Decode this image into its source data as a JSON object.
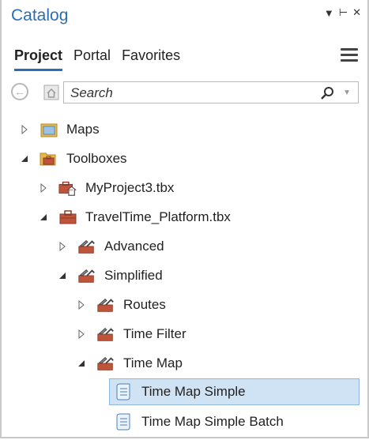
{
  "panel": {
    "title": "Catalog"
  },
  "tabs": [
    {
      "label": "Project",
      "active": true
    },
    {
      "label": "Portal",
      "active": false
    },
    {
      "label": "Favorites",
      "active": false
    }
  ],
  "search": {
    "placeholder": "Search"
  },
  "tree": [
    {
      "label": "Maps",
      "icon": "maps-folder-icon",
      "expanded": false
    },
    {
      "label": "Toolboxes",
      "icon": "folder-open-icon",
      "expanded": true
    },
    {
      "label": "MyProject3.tbx",
      "icon": "toolbox-home-icon",
      "expanded": false
    },
    {
      "label": "TravelTime_Platform.tbx",
      "icon": "toolbox-icon",
      "expanded": true
    },
    {
      "label": "Advanced",
      "icon": "toolset-icon",
      "expanded": false
    },
    {
      "label": "Simplified",
      "icon": "toolset-icon",
      "expanded": true
    },
    {
      "label": "Routes",
      "icon": "toolset-icon",
      "expanded": false
    },
    {
      "label": "Time Filter",
      "icon": "toolset-icon",
      "expanded": false
    },
    {
      "label": "Time Map",
      "icon": "toolset-icon",
      "expanded": true
    },
    {
      "label": "Time Map Simple",
      "icon": "script-tool-icon",
      "selected": true
    },
    {
      "label": "Time Map Simple Batch",
      "icon": "script-tool-icon",
      "selected": false
    }
  ],
  "colors": {
    "accent": "#2a6eb7",
    "selection": "#cfe3f5",
    "toolbox_red": "#c0543a",
    "folder_yellow": "#e7b84a"
  }
}
